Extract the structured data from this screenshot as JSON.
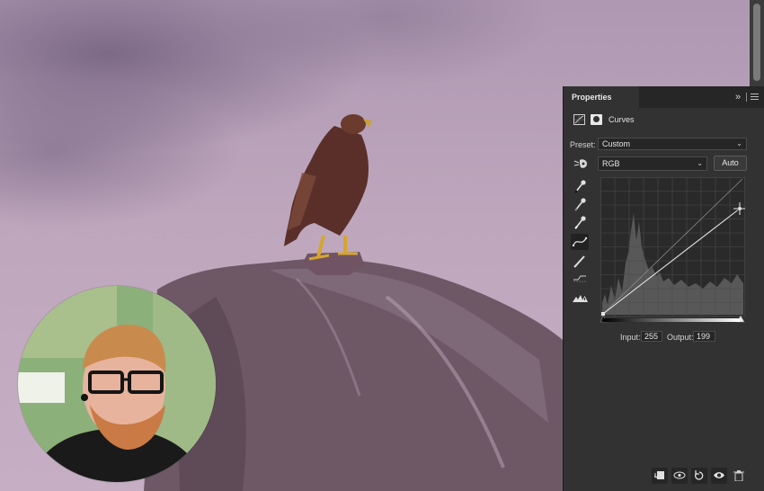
{
  "panel": {
    "tab_label": "Properties",
    "adjustment_title": "Curves",
    "preset_label": "Preset:",
    "preset_value": "Custom",
    "channel_value": "RGB",
    "auto_label": "Auto",
    "input_label": "Input:",
    "input_value": "255",
    "output_label": "Output:",
    "output_value": "199"
  },
  "icons": {
    "panel_collapse": "double-chevron-right-icon",
    "panel_menu": "hamburger-menu-icon",
    "adjustment": "curves-adjustment-icon",
    "mask": "layer-mask-icon",
    "on_image": "targeted-adjustment-hand-icon",
    "tools": [
      "eyedropper-black-icon",
      "eyedropper-gray-icon",
      "eyedropper-white-icon",
      "curve-draw-icon",
      "pencil-icon",
      "smooth-icon",
      "clipping-warning-icon"
    ],
    "footer": [
      "clip-to-layer-icon",
      "view-previous-state-icon",
      "reset-icon",
      "visibility-icon",
      "delete-icon"
    ]
  },
  "colors": {
    "panel_bg": "#323232",
    "panel_header_bg": "#262626",
    "graph_bg": "#2a2a2a",
    "curve_line": "#e6e6e6",
    "sky": "#bea7bd"
  },
  "curve": {
    "points": [
      [
        0,
        0
      ],
      [
        255,
        199
      ]
    ]
  }
}
